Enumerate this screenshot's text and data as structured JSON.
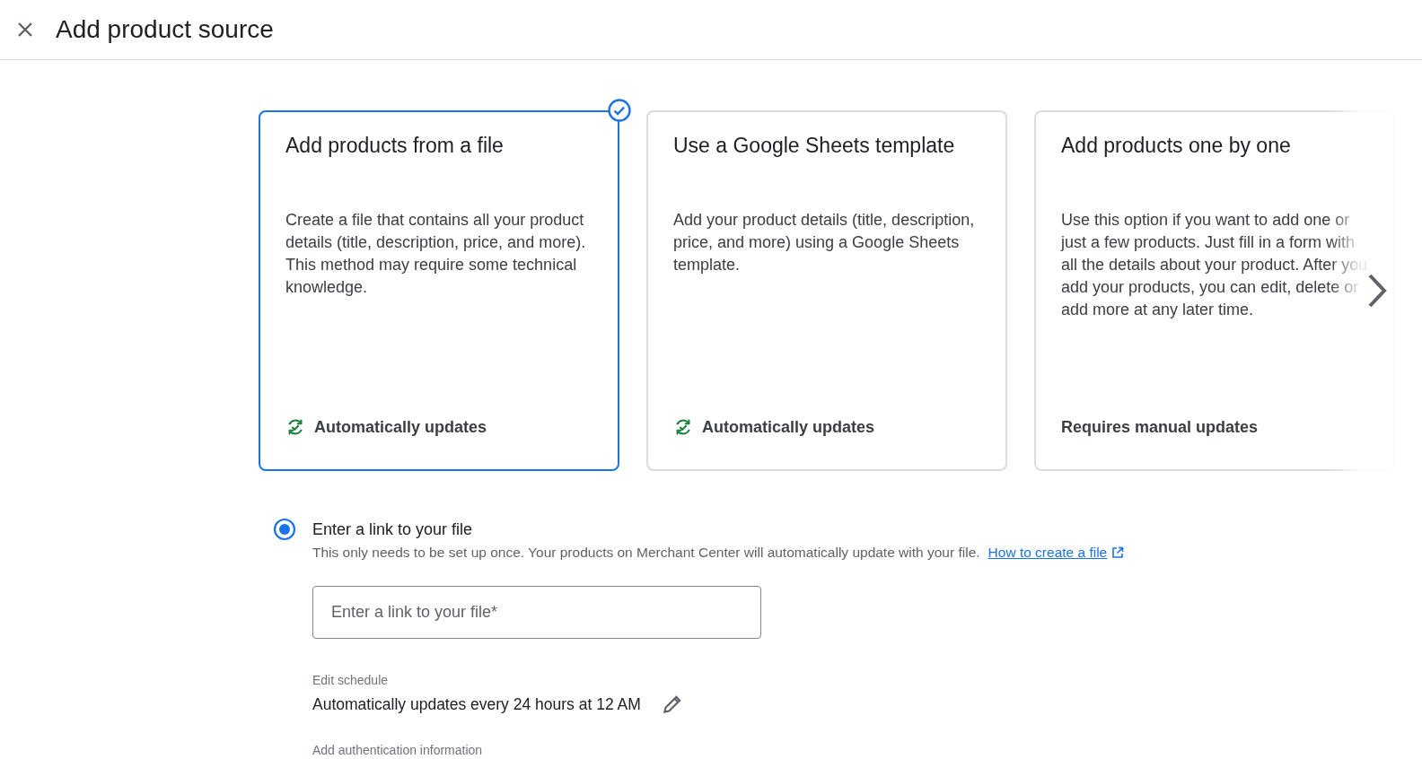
{
  "header": {
    "title": "Add product source"
  },
  "cards": [
    {
      "title": "Add products from a file",
      "description": "Create a file that contains all your product details (title, description, price, and more). This method may require some technical knowledge.",
      "footer": "Automatically updates",
      "kind": "auto",
      "selected": true
    },
    {
      "title": "Use a Google Sheets template",
      "description": "Add your product details (title, description, price, and more) using a Google Sheets template.",
      "footer": "Automatically updates",
      "kind": "auto",
      "selected": false
    },
    {
      "title": "Add products one by one",
      "description": "Use this option if you want to add one or just a few products. Just fill in a form with all the details about your product. After you add your products, you can edit, delete or add more at any later time.",
      "footer": "Requires manual updates",
      "kind": "manual",
      "selected": false
    }
  ],
  "link_option": {
    "label": "Enter a link to your file",
    "selected": true,
    "help": "This only needs to be set up once. Your products on Merchant Center will automatically update with your file.",
    "help_link": "How to create a file",
    "field_placeholder": "Enter a link to your file*"
  },
  "schedule": {
    "label": "Edit schedule",
    "value": "Automatically updates every 24 hours at 12 AM"
  },
  "auth": {
    "label": "Add authentication information"
  }
}
